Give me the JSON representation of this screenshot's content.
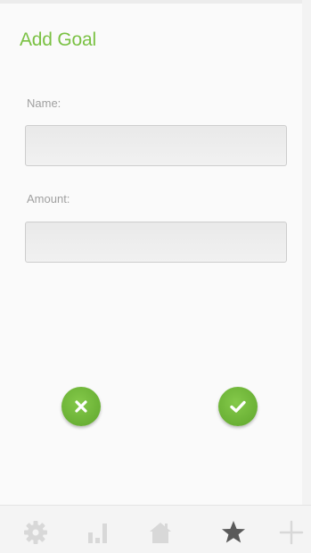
{
  "header": {
    "title": "Add Goal"
  },
  "form": {
    "name_label": "Name:",
    "name_value": "",
    "amount_label": "Amount:",
    "amount_value": ""
  },
  "actions": {
    "cancel_icon": "close-icon",
    "confirm_icon": "check-icon"
  },
  "tabbar": {
    "items": [
      {
        "icon": "gear-icon",
        "active": false
      },
      {
        "icon": "bar-chart-icon",
        "active": false
      },
      {
        "icon": "home-icon",
        "active": false
      },
      {
        "icon": "star-icon",
        "active": true
      },
      {
        "icon": "plus-icon",
        "active": false
      }
    ]
  },
  "colors": {
    "accent": "#7ac143",
    "button_green": "#6db535",
    "label_gray": "#a0a0a0",
    "tab_icon_inactive": "#d8d8d8",
    "tab_icon_active": "#5a5a5a"
  }
}
